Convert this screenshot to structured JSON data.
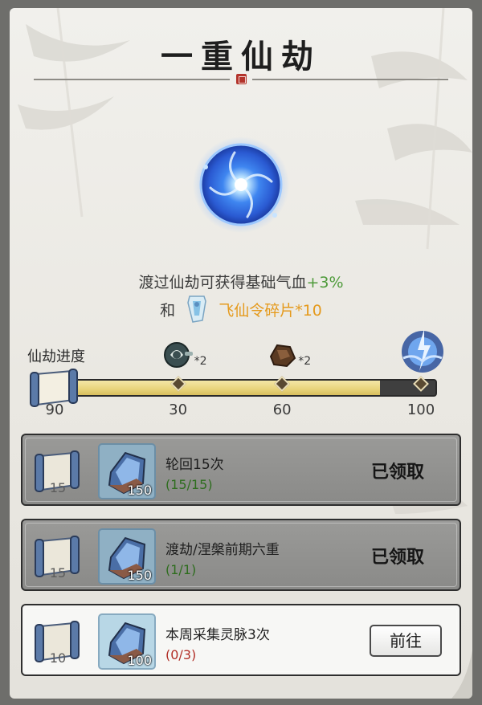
{
  "title": "一重仙劫",
  "reward": {
    "line1_prefix": "渡过仙劫可获得基础气血",
    "line1_bonus": "+3%",
    "line2_prefix": "和",
    "line2_item": "飞仙令碎片*10"
  },
  "progress": {
    "label": "仙劫进度",
    "current": 90,
    "max": 100,
    "current_label": "90",
    "milestones": [
      {
        "label": "30",
        "value": 30,
        "icon": "ring-pendant-icon",
        "multiplier": "*2"
      },
      {
        "label": "60",
        "value": 60,
        "icon": "ore-chunk-icon",
        "multiplier": "*2"
      },
      {
        "label": "100",
        "value": 100,
        "icon": "lightning-spirit-icon"
      }
    ]
  },
  "tasks": [
    {
      "name": "轮回15次",
      "progress": "(15/15)",
      "scroll_qty": "15",
      "crystal_qty": "150",
      "state": "done",
      "status": "已领取"
    },
    {
      "name": "渡劫/涅槃前期六重",
      "progress": "(1/1)",
      "scroll_qty": "15",
      "crystal_qty": "150",
      "state": "done",
      "status": "已领取"
    },
    {
      "name": "本周采集灵脉3次",
      "progress": "(0/3)",
      "scroll_qty": "10",
      "crystal_qty": "100",
      "state": "active",
      "button": "前往"
    }
  ],
  "colors": {
    "bonus_green": "#4e9a3a",
    "item_orange": "#e59a1c",
    "progress_red": "#b12d25",
    "progress_done_green": "#2e6d1e"
  }
}
